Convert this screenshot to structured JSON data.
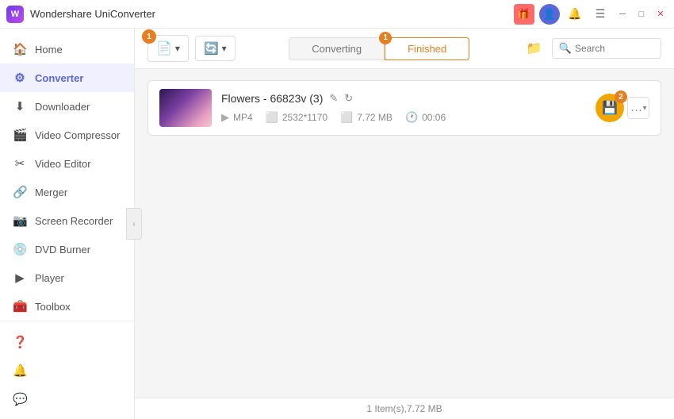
{
  "app": {
    "title": "Wondershare UniConverter",
    "logo_letter": "W"
  },
  "titlebar": {
    "gift_icon": "🎁",
    "user_icon": "👤",
    "bell_icon": "🔔",
    "menu_icon": "☰",
    "minimize_icon": "─",
    "maximize_icon": "□",
    "close_icon": "✕"
  },
  "sidebar": {
    "items": [
      {
        "id": "home",
        "label": "Home",
        "icon": "🏠",
        "active": false
      },
      {
        "id": "converter",
        "label": "Converter",
        "icon": "⚙",
        "active": true
      },
      {
        "id": "downloader",
        "label": "Downloader",
        "icon": "⬇",
        "active": false
      },
      {
        "id": "video-compressor",
        "label": "Video Compressor",
        "icon": "🎬",
        "active": false
      },
      {
        "id": "video-editor",
        "label": "Video Editor",
        "icon": "✂",
        "active": false
      },
      {
        "id": "merger",
        "label": "Merger",
        "icon": "🔗",
        "active": false
      },
      {
        "id": "screen-recorder",
        "label": "Screen Recorder",
        "icon": "📷",
        "active": false
      },
      {
        "id": "dvd-burner",
        "label": "DVD Burner",
        "icon": "💿",
        "active": false
      },
      {
        "id": "player",
        "label": "Player",
        "icon": "▶",
        "active": false
      },
      {
        "id": "toolbox",
        "label": "Toolbox",
        "icon": "🧰",
        "active": false
      }
    ],
    "bottom_items": [
      {
        "id": "help",
        "label": "Help",
        "icon": "❓"
      },
      {
        "id": "notifications",
        "label": "Notifications",
        "icon": "🔔"
      },
      {
        "id": "feedback",
        "label": "Feedback",
        "icon": "💬"
      }
    ]
  },
  "toolbar": {
    "add_button_label": "+ Add",
    "convert_button_label": "+ Convert",
    "tab_converting": "Converting",
    "tab_finished": "Finished",
    "search_placeholder": "Search",
    "folder_icon": "📁"
  },
  "file_item": {
    "name": "Flowers - 66823v (3)",
    "format": "MP4",
    "resolution": "2532*1170",
    "size": "7.72 MB",
    "duration": "00:06",
    "save_icon": "💾",
    "edit_icon": "✎",
    "refresh_icon": "↻",
    "more_icon": "…",
    "badge_number_1": "1",
    "badge_number_2": "2"
  },
  "status_bar": {
    "text": "1 Item(s),7.72 MB"
  }
}
